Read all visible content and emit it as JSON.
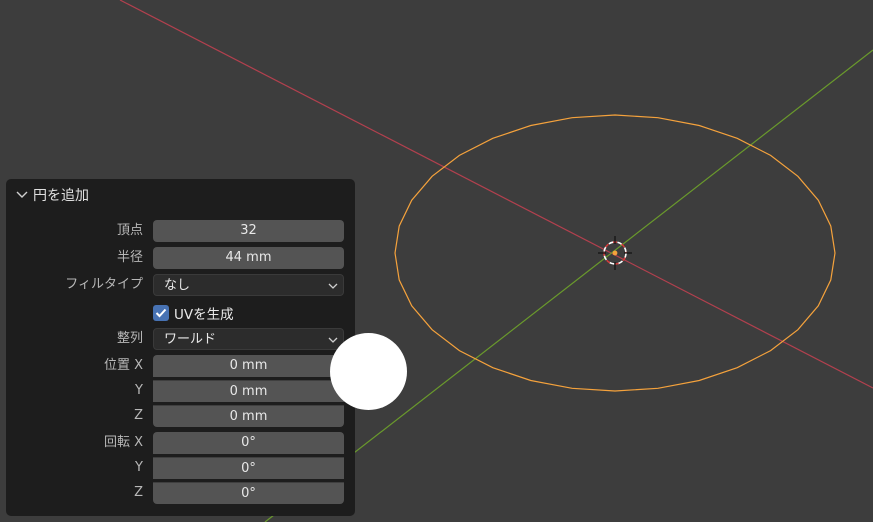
{
  "operator_panel": {
    "title": "円を追加",
    "vertices": {
      "label": "頂点",
      "value": "32"
    },
    "radius": {
      "label": "半径",
      "value": "44 mm"
    },
    "fill_type": {
      "label": "フィルタイプ",
      "value": "なし"
    },
    "generate_uvs": {
      "label": "UVを生成",
      "checked": true
    },
    "align": {
      "label": "整列",
      "value": "ワールド"
    },
    "location": {
      "label_x": "位置 X",
      "label_y": "Y",
      "label_z": "Z",
      "x": "0 mm",
      "y": "0 mm",
      "z": "0 mm"
    },
    "rotation": {
      "label_x": "回転 X",
      "label_y": "Y",
      "label_z": "Z",
      "x": "0°",
      "y": "0°",
      "z": "0°"
    }
  },
  "colors": {
    "viewport_bg": "#3d3d3d",
    "panel_bg": "#1d1d1d",
    "field_bg": "#545454",
    "checkbox_accent": "#4772b3",
    "x_axis": "#b2404e",
    "y_axis": "#6a9a2c",
    "selection_outline": "#f5a23c"
  },
  "icons": {
    "collapse": "chevron-down-icon",
    "dropdown": "chevron-down-icon",
    "checkbox": "checkmark-icon",
    "origin": "3d-cursor-icon"
  }
}
